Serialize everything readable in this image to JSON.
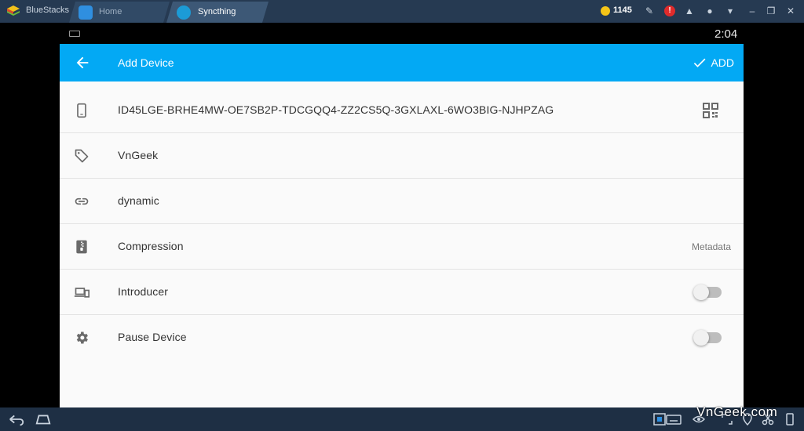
{
  "window": {
    "app_name": "BlueStacks",
    "tabs": [
      {
        "label": "Home",
        "icon": "home-icon"
      },
      {
        "label": "Syncthing",
        "icon": "syncthing-icon"
      }
    ],
    "coins": "1145"
  },
  "status_bar": {
    "time": "2:04"
  },
  "appbar": {
    "title": "Add Device",
    "action_label": "ADD"
  },
  "rows": [
    {
      "icon": "phone-icon",
      "text": "ID45LGE-BRHE4MW-OE7SB2P-TDCGQQ4-ZZ2CS5Q-3GXLAXL-6WO3BIG-NJHPZAG"
    },
    {
      "icon": "tag-icon",
      "text": "VnGeek"
    },
    {
      "icon": "link-icon",
      "text": "dynamic"
    },
    {
      "icon": "zip-icon",
      "text": "Compression",
      "value": "Metadata"
    },
    {
      "icon": "devices-icon",
      "text": "Introducer",
      "switch_on": false
    },
    {
      "icon": "gear-icon",
      "text": "Pause Device",
      "switch_on": false
    }
  ],
  "watermark": "VnGeek.com",
  "colors": {
    "accent": "#03a9f4",
    "titlebar": "#263a52",
    "bottombar": "#1e2f44"
  }
}
